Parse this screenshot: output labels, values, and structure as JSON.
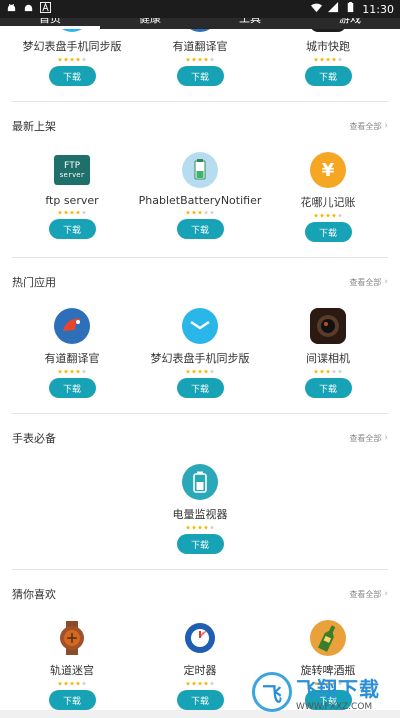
{
  "status": {
    "time": "11:30"
  },
  "tabs": [
    {
      "label": "首页",
      "active": true
    },
    {
      "label": "健康",
      "active": false
    },
    {
      "label": "工具",
      "active": false
    },
    {
      "label": "游戏",
      "active": false
    }
  ],
  "download_label": "下载",
  "top_row": [
    {
      "name": "梦幻表盘手机同步版",
      "rating": 4,
      "icon": "watch-face-icon"
    },
    {
      "name": "有道翻译官",
      "rating": 4,
      "icon": "parrot-icon"
    },
    {
      "name": "城市快跑",
      "rating": 4,
      "icon": "runner-game-icon"
    }
  ],
  "sections": [
    {
      "title": "最新上架",
      "see_all": "查看全部",
      "apps": [
        {
          "name": "ftp server",
          "rating": 4,
          "icon": "ftp-server-icon",
          "icon_text_1": "FTP",
          "icon_text_2": "server"
        },
        {
          "name": "PhabletBatteryNotifier",
          "rating": 3,
          "icon": "battery-notifier-icon"
        },
        {
          "name": "花哪儿记账",
          "rating": 4,
          "icon": "yuan-coin-icon",
          "icon_text_1": "¥"
        }
      ]
    },
    {
      "title": "热门应用",
      "see_all": "查看全部",
      "apps": [
        {
          "name": "有道翻译官",
          "rating": 4,
          "icon": "parrot-icon"
        },
        {
          "name": "梦幻表盘手机同步版",
          "rating": 4,
          "icon": "watch-face-icon"
        },
        {
          "name": "间谍相机",
          "rating": 3,
          "icon": "camera-lens-icon"
        }
      ]
    },
    {
      "title": "手表必备",
      "see_all": "查看全部",
      "apps": [
        {
          "name": "电量监视器",
          "rating": 4,
          "icon": "battery-monitor-icon"
        }
      ]
    },
    {
      "title": "猜你喜欢",
      "see_all": "查看全部",
      "apps": [
        {
          "name": "轨道迷宫",
          "rating": 4,
          "icon": "maze-watch-icon"
        },
        {
          "name": "定时器",
          "rating": 4,
          "icon": "timer-watch-icon"
        },
        {
          "name": "旋转啤酒瓶",
          "rating": 4,
          "icon": "beer-bottle-icon"
        }
      ]
    }
  ],
  "colors": {
    "accent": "#17a3b5",
    "star": "#f5b400",
    "status_bar": "#1c1c1c"
  },
  "watermark": {
    "logo_text": "飞",
    "main": "飞翔下载",
    "url": "WWW.FXXZ.COM"
  }
}
